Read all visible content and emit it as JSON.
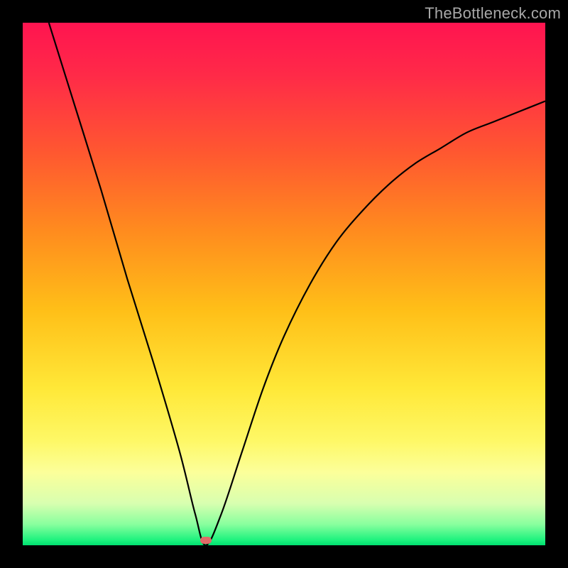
{
  "watermark": "TheBottleneck.com",
  "chart_data": {
    "type": "line",
    "title": "",
    "xlabel": "",
    "ylabel": "",
    "xlim": [
      0,
      100
    ],
    "ylim": [
      0,
      100
    ],
    "grid": false,
    "legend": false,
    "series": [
      {
        "name": "bottleneck-curve",
        "x": [
          5,
          10,
          15,
          20,
          25,
          30,
          33,
          35,
          38,
          42,
          46,
          50,
          55,
          60,
          65,
          70,
          75,
          80,
          85,
          90,
          95,
          100
        ],
        "y": [
          100,
          84,
          68,
          51,
          35,
          18,
          6,
          0,
          6,
          18,
          30,
          40,
          50,
          58,
          64,
          69,
          73,
          76,
          79,
          81,
          83,
          85
        ]
      }
    ],
    "marker": {
      "x": 35,
      "y": 1,
      "color": "#e06a68"
    },
    "background_gradient": {
      "direction": "vertical",
      "stops": [
        {
          "pos": 0,
          "color": "#ff1450"
        },
        {
          "pos": 25,
          "color": "#ff5830"
        },
        {
          "pos": 55,
          "color": "#ffbf18"
        },
        {
          "pos": 80,
          "color": "#fcff9a"
        },
        {
          "pos": 96,
          "color": "#88ff9e"
        },
        {
          "pos": 100,
          "color": "#00e070"
        }
      ]
    }
  }
}
